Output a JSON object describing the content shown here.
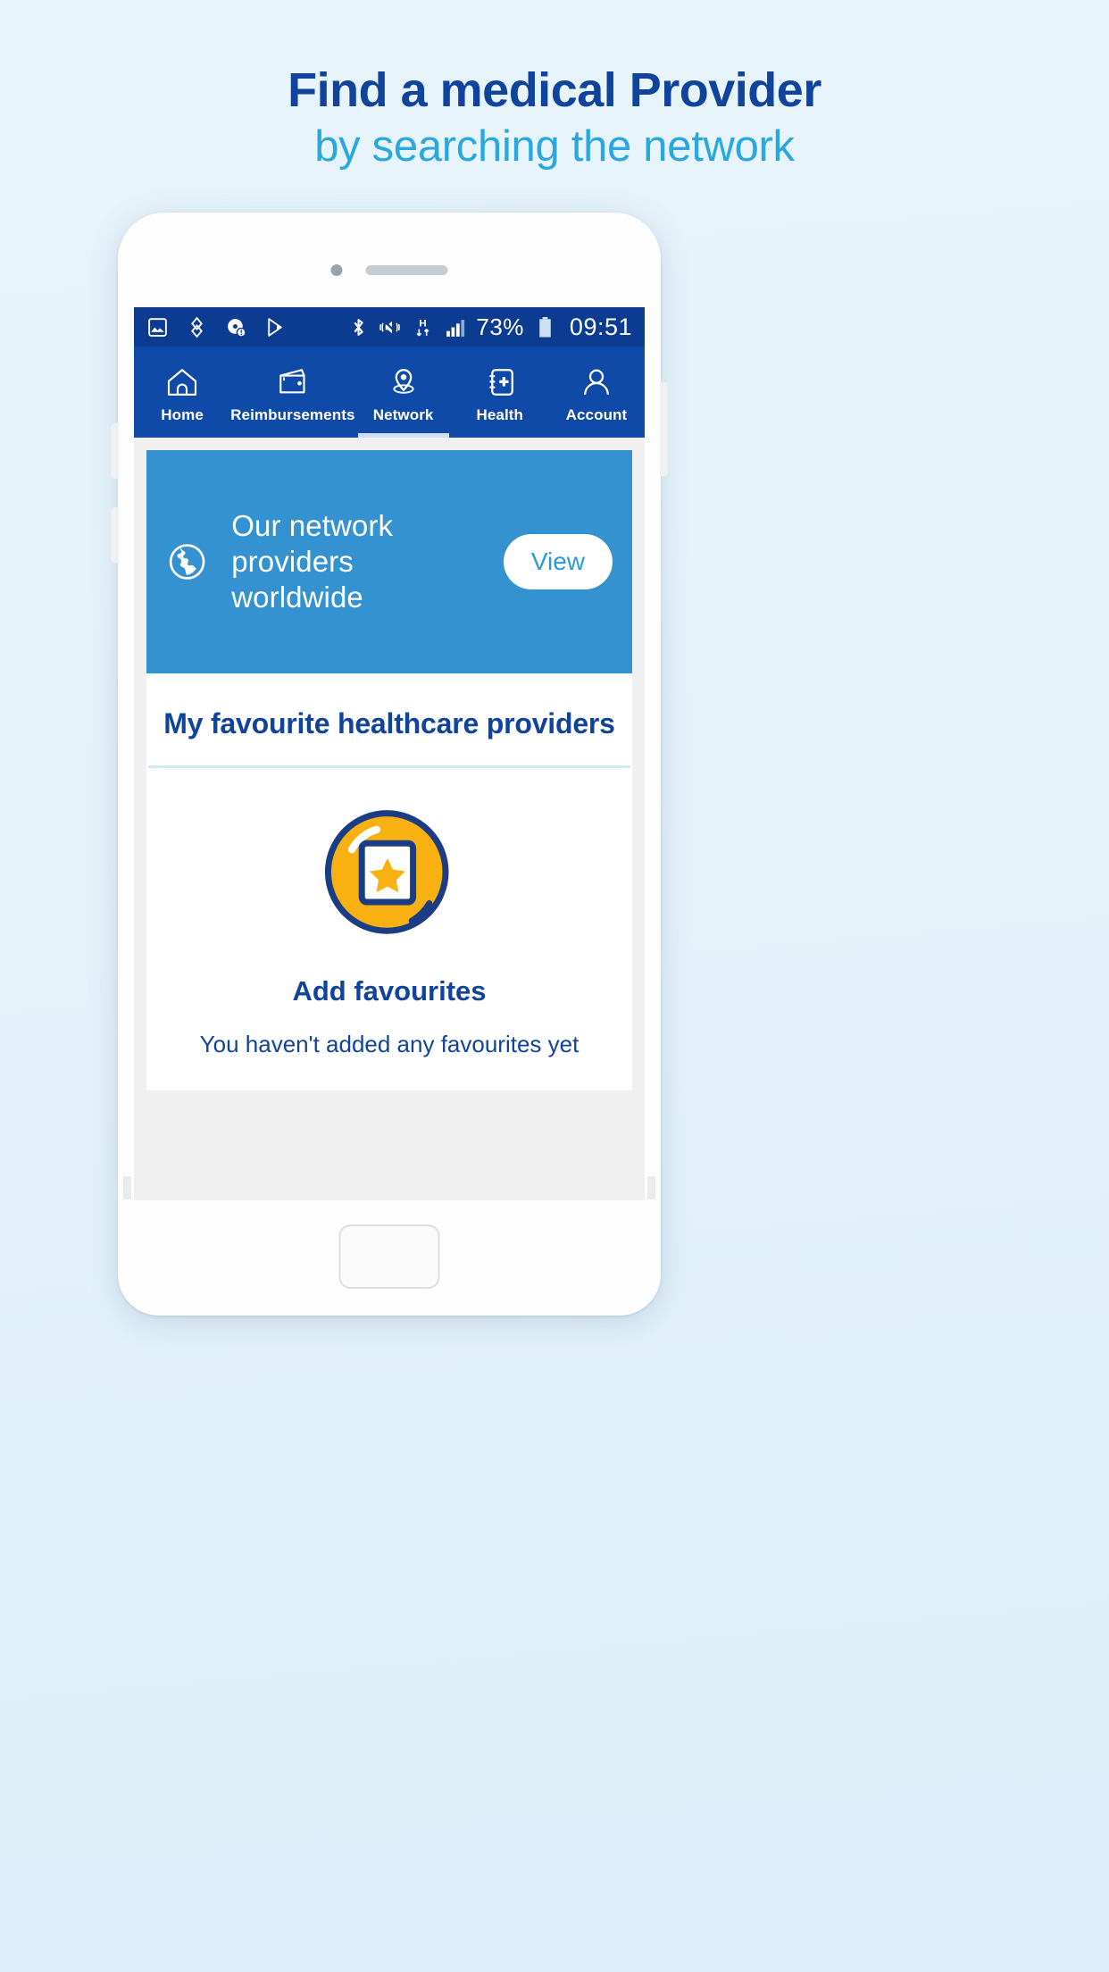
{
  "promo": {
    "title": "Find a medical Provider",
    "subtitle": "by searching the network",
    "title_color": "#10439b",
    "subtitle_color": "#29a8e0"
  },
  "status_bar": {
    "battery_percent": "73%",
    "time": "09:51",
    "left_icons": [
      "image-icon",
      "location-crosshair-icon",
      "disc-alert-icon",
      "play-store-icon"
    ],
    "right_icons": [
      "bluetooth-icon",
      "mute-vibrate-icon",
      "hspa-data-icon",
      "signal-bars-icon",
      "battery-icon"
    ]
  },
  "nav": {
    "tabs": [
      {
        "label": "Home",
        "icon": "home-icon",
        "active": false
      },
      {
        "label": "Reimbursements",
        "icon": "wallet-icon",
        "active": false
      },
      {
        "label": "Network",
        "icon": "map-pin-icon",
        "active": true
      },
      {
        "label": "Health",
        "icon": "health-book-icon",
        "active": false
      },
      {
        "label": "Account",
        "icon": "person-icon",
        "active": false
      }
    ],
    "background_color": "#0f4aa8",
    "active_indicator_color": "#cfe0f5"
  },
  "banner": {
    "icon": "globe-icon",
    "text": "Our network providers worldwide",
    "button_label": "View",
    "background_color": "#3492d0",
    "button_text_color": "#2b9ad9"
  },
  "favourites": {
    "section_title": "My favourite healthcare providers",
    "icon": "star-document-circle-icon",
    "link_label": "Add favourites",
    "empty_message": "You haven't added any favourites yet",
    "icon_fill_color": "#f9b111",
    "icon_stroke_color": "#1b3d85"
  }
}
